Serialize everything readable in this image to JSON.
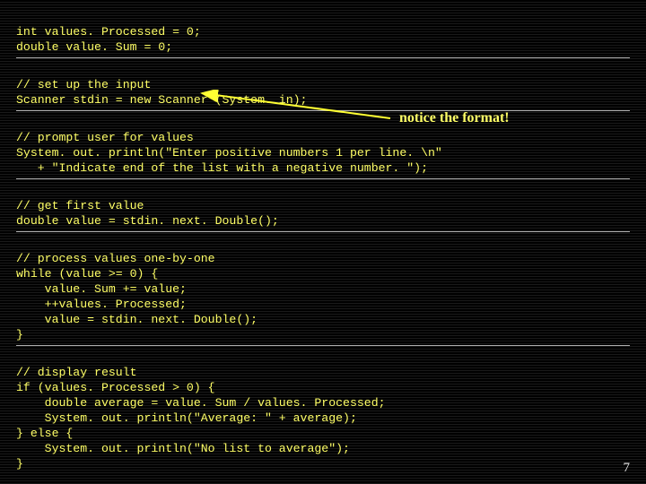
{
  "code": {
    "l1": "int values. Processed = 0;",
    "l2": "double value. Sum = 0;",
    "l3": "// set up the input",
    "l4": "Scanner stdin = new Scanner (System. in);",
    "l5": "// prompt user for values",
    "l6": "System. out. println(\"Enter positive numbers 1 per line. \\n\"",
    "l7": "   + \"Indicate end of the list with a negative number. \");",
    "l8": "// get first value",
    "l9": "double value = stdin. next. Double();",
    "l10": "// process values one-by-one",
    "l11": "while (value >= 0) {",
    "l12": "    value. Sum += value;",
    "l13": "    ++values. Processed;",
    "l14": "    value = stdin. next. Double();",
    "l15": "}",
    "l16": "// display result",
    "l17": "if (values. Processed > 0) {",
    "l18": "    double average = value. Sum / values. Processed;",
    "l19": "    System. out. println(\"Average: \" + average);",
    "l20": "} else {",
    "l21": "    System. out. println(\"No list to average\");",
    "l22": "}"
  },
  "annotation": {
    "text": "notice the format!"
  },
  "page_number": "7"
}
